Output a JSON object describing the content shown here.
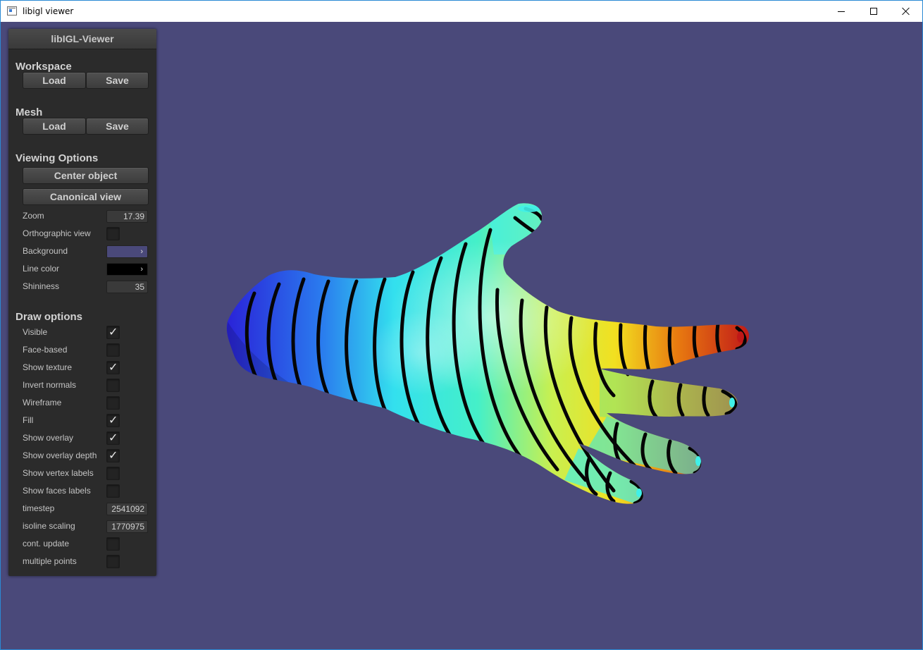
{
  "window": {
    "title": "libigl viewer",
    "controls": {
      "minimize": "minimize-icon",
      "maximize": "maximize-icon",
      "close": "close-icon"
    }
  },
  "colors": {
    "viewport_background": "#4a497a",
    "panel_background": "#2b2b2b",
    "background_swatch": "#4a497a",
    "line_color_swatch": "#000000"
  },
  "panel": {
    "title": "libIGL-Viewer",
    "workspace": {
      "title": "Workspace",
      "load": "Load",
      "save": "Save"
    },
    "mesh": {
      "title": "Mesh",
      "load": "Load",
      "save": "Save"
    },
    "viewing": {
      "title": "Viewing Options",
      "center_object": "Center object",
      "canonical_view": "Canonical view",
      "zoom_label": "Zoom",
      "zoom_value": "17.39",
      "orthographic_label": "Orthographic view",
      "orthographic_checked": false,
      "background_label": "Background",
      "line_color_label": "Line color",
      "shininess_label": "Shininess",
      "shininess_value": "35"
    },
    "draw": {
      "title": "Draw options",
      "visible": "Visible",
      "face_based": "Face-based",
      "show_texture": "Show texture",
      "invert_normals": "Invert normals",
      "wireframe": "Wireframe",
      "fill": "Fill",
      "show_overlay": "Show overlay",
      "show_overlay_depth": "Show overlay depth",
      "show_vertex_labels": "Show vertex labels",
      "show_faces_labels": "Show faces labels",
      "timestep_label": "timestep",
      "timestep_value": "2541092",
      "isoline_label": "isoline scaling",
      "isoline_value": "1770975",
      "cont_update": "cont. update",
      "multiple_points": "multiple points"
    }
  }
}
